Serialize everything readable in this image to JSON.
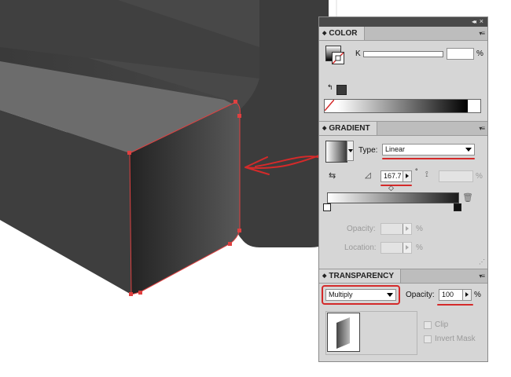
{
  "panels": {
    "color": {
      "title": "COLOR",
      "channel_label": "K",
      "unit": "%",
      "channel_value": ""
    },
    "gradient": {
      "title": "GRADIENT",
      "type_label": "Type:",
      "type_value": "Linear",
      "angle_value": "167.7",
      "angle_degree": "°",
      "aspect_unit": "%",
      "opacity_label": "Opacity:",
      "opacity_unit": "%",
      "location_label": "Location:",
      "location_unit": "%"
    },
    "transparency": {
      "title": "TRANSPARENCY",
      "blend_mode": "Multiply",
      "opacity_label": "Opacity:",
      "opacity_value": "100",
      "opacity_unit": "%",
      "clip_label": "Clip",
      "invert_mask_label": "Invert Mask"
    }
  },
  "colors": {
    "annotation": "#d42a2a",
    "canvas_dark": "#3a3a3a",
    "panel_bg": "#d6d6d6"
  }
}
